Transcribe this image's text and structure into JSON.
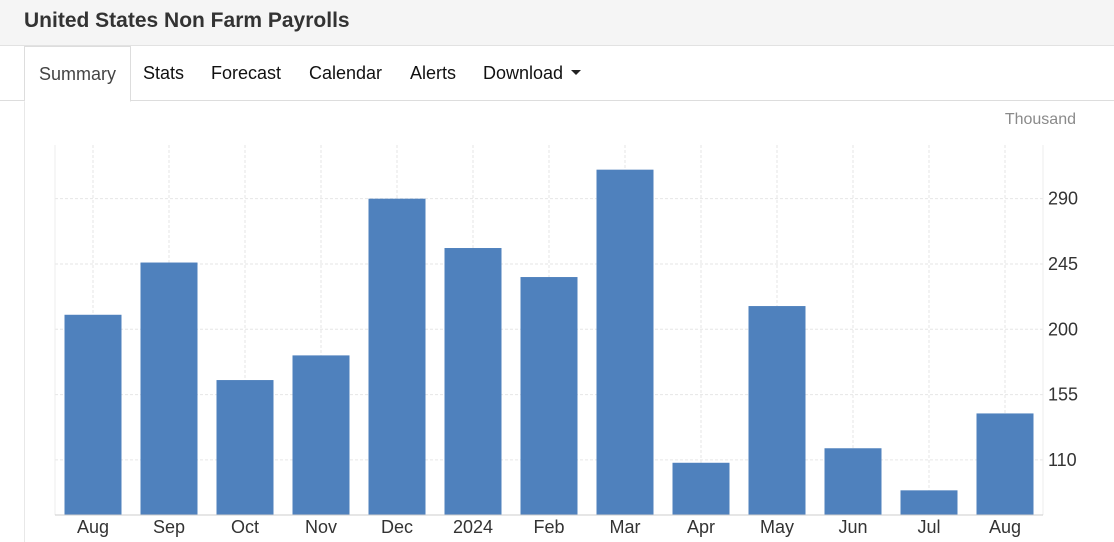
{
  "page": {
    "title": "United States Non Farm Payrolls"
  },
  "tabs": [
    {
      "label": "Summary",
      "active": true
    },
    {
      "label": "Stats",
      "active": false
    },
    {
      "label": "Forecast",
      "active": false
    },
    {
      "label": "Calendar",
      "active": false
    },
    {
      "label": "Alerts",
      "active": false
    },
    {
      "label": "Download",
      "active": false,
      "has_dropdown": true,
      "icon": "caret-down-icon"
    }
  ],
  "chart_data": {
    "type": "bar",
    "unit": "Thousand",
    "categories": [
      "Aug",
      "Sep",
      "Oct",
      "Nov",
      "Dec",
      "2024",
      "Feb",
      "Mar",
      "Apr",
      "May",
      "Jun",
      "Jul",
      "Aug"
    ],
    "values": [
      210,
      246,
      165,
      182,
      290,
      256,
      236,
      310,
      108,
      216,
      118,
      89,
      142
    ],
    "y_ticks": [
      110,
      155,
      200,
      245,
      290
    ],
    "ylim": [
      72,
      327
    ],
    "grid": true,
    "y_axis_position": "right",
    "bar_color": "#4f81bd",
    "grid_color": "#e6e6e6"
  }
}
